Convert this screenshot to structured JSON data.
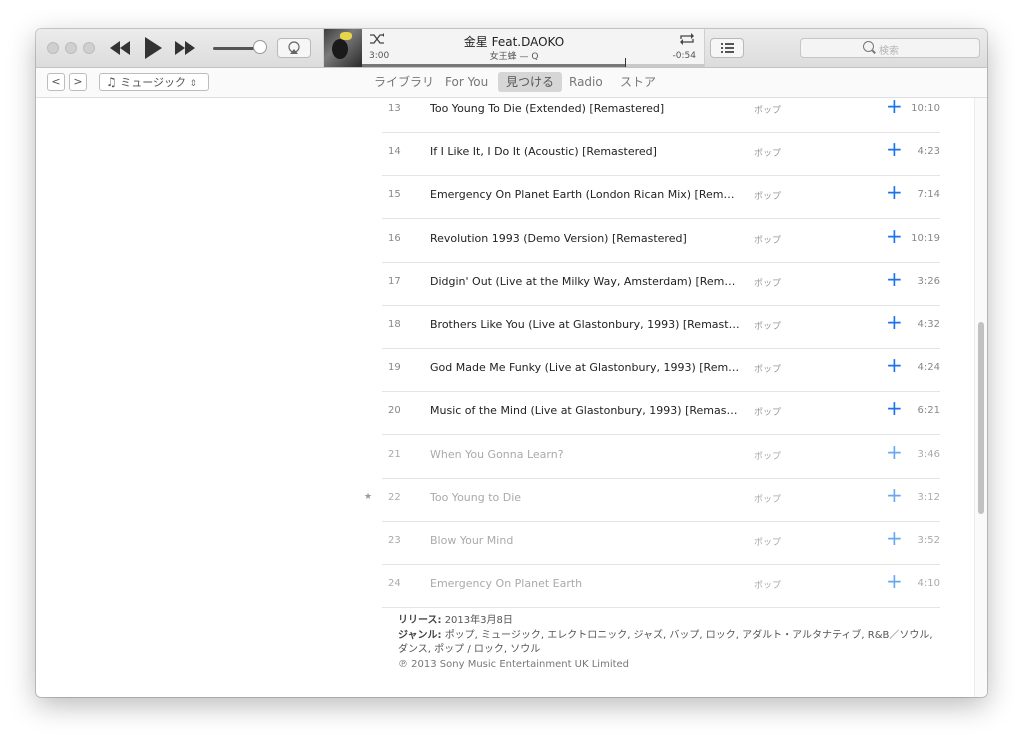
{
  "now_playing": {
    "title": "金星 Feat.DAOKO",
    "subtitle": "女王蜂 — Q",
    "elapsed": "3:00",
    "remaining": "-0:54",
    "progress_fraction": 0.77
  },
  "toolbar": {
    "search_placeholder": "検索"
  },
  "nav": {
    "back": "<",
    "forward": ">",
    "media_kind": "ミュージック",
    "tabs": [
      {
        "label": "ライブラリ",
        "active": false
      },
      {
        "label": "For You",
        "active": false
      },
      {
        "label": "見つける",
        "active": true
      },
      {
        "label": "Radio",
        "active": false
      },
      {
        "label": "ストア",
        "active": false
      }
    ]
  },
  "tracks": [
    {
      "num": "13",
      "title": "Too Young To Die (Extended) [Remastered]",
      "genre": "ポップ",
      "duration": "10:10",
      "available": true,
      "starred": false
    },
    {
      "num": "14",
      "title": "If I Like It, I Do It (Acoustic) [Remastered]",
      "genre": "ポップ",
      "duration": "4:23",
      "available": true,
      "starred": false
    },
    {
      "num": "15",
      "title": "Emergency On Planet Earth (London Rican Mix) [Remast...",
      "genre": "ポップ",
      "duration": "7:14",
      "available": true,
      "starred": false
    },
    {
      "num": "16",
      "title": "Revolution 1993 (Demo Version) [Remastered]",
      "genre": "ポップ",
      "duration": "10:19",
      "available": true,
      "starred": false
    },
    {
      "num": "17",
      "title": "Didgin' Out (Live at the Milky Way, Amsterdam) [Remaste...",
      "genre": "ポップ",
      "duration": "3:26",
      "available": true,
      "starred": false
    },
    {
      "num": "18",
      "title": "Brothers Like You (Live at Glastonbury, 1993) [Remastere...",
      "genre": "ポップ",
      "duration": "4:32",
      "available": true,
      "starred": false
    },
    {
      "num": "19",
      "title": "God Made Me Funky (Live at Glastonbury, 1993) [Remast...",
      "genre": "ポップ",
      "duration": "4:24",
      "available": true,
      "starred": false
    },
    {
      "num": "20",
      "title": "Music of the Mind (Live at Glastonbury, 1993) [Remaster...",
      "genre": "ポップ",
      "duration": "6:21",
      "available": true,
      "starred": false
    },
    {
      "num": "21",
      "title": "When You Gonna Learn?",
      "genre": "ポップ",
      "duration": "3:46",
      "available": false,
      "starred": false
    },
    {
      "num": "22",
      "title": "Too Young to Die",
      "genre": "ポップ",
      "duration": "3:12",
      "available": false,
      "starred": true
    },
    {
      "num": "23",
      "title": "Blow Your Mind",
      "genre": "ポップ",
      "duration": "3:52",
      "available": false,
      "starred": false
    },
    {
      "num": "24",
      "title": "Emergency On Planet Earth",
      "genre": "ポップ",
      "duration": "4:10",
      "available": false,
      "starred": false
    }
  ],
  "footer": {
    "release_label": "リリース:",
    "release_value": "2013年3月8日",
    "genre_label": "ジャンル:",
    "genre_value": "ポップ, ミュージック, エレクトロニック, ジャズ, バップ, ロック, アダルト・アルタナティブ, R&B／ソウル, ダンス, ポップ / ロック, ソウル",
    "copyright": "℗ 2013 Sony Music Entertainment UK Limited"
  },
  "icons": {
    "add": "+",
    "star": "★"
  },
  "colors": {
    "accent": "#1a73e8"
  }
}
